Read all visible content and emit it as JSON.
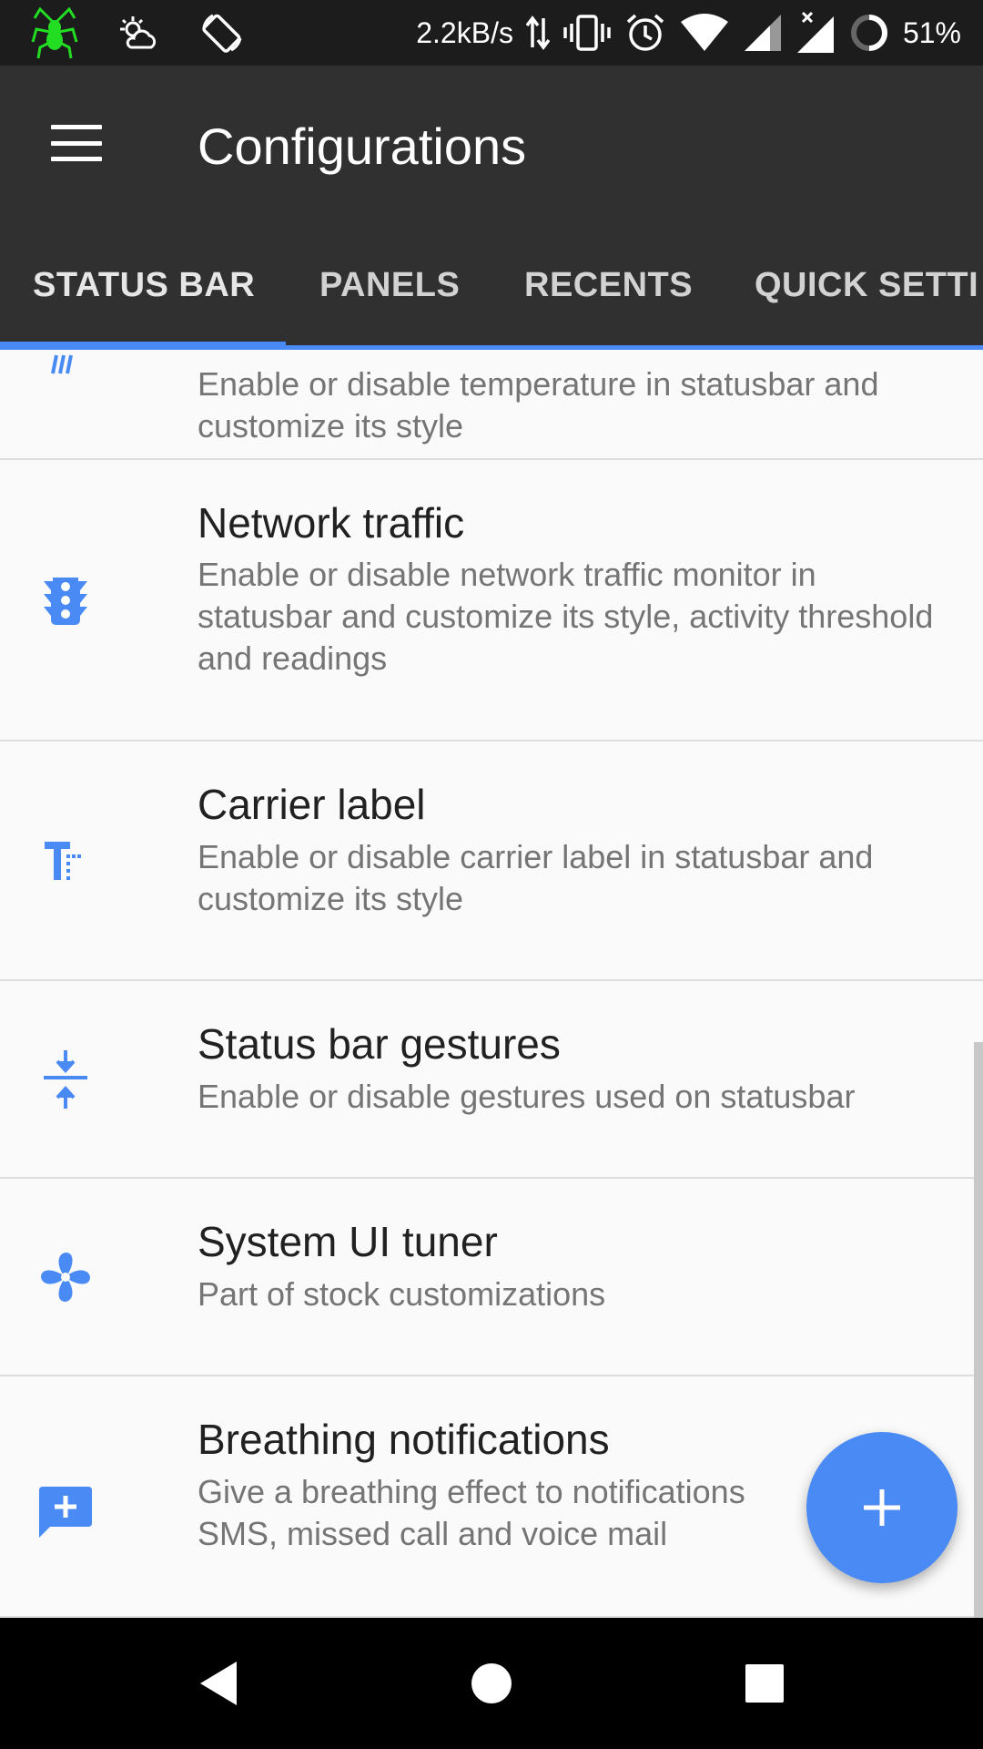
{
  "status_bar": {
    "net_speed": "2.2kB/s",
    "battery_pct": "51%",
    "icons": [
      "spider-app-icon",
      "weather-icon",
      "rotation-icon",
      "data-arrows-icon",
      "vibrate-icon",
      "alarm-icon",
      "wifi-icon",
      "signal-icon",
      "signal-no-data-icon",
      "battery-ring-icon"
    ]
  },
  "app_bar": {
    "title": "Configurations",
    "menu_icon": "hamburger-menu-icon"
  },
  "tabs": [
    {
      "label": "STATUS BAR",
      "active": true
    },
    {
      "label": "PANELS",
      "active": false
    },
    {
      "label": "RECENTS",
      "active": false
    },
    {
      "label": "QUICK SETTI",
      "active": false
    }
  ],
  "items": [
    {
      "title": "",
      "desc": "Enable or disable temperature in statusbar and customize its style",
      "icon": "thermometer-icon"
    },
    {
      "title": "Network traffic",
      "desc": "Enable or disable network traffic monitor in statusbar and customize its style, activity threshold and readings",
      "icon": "traffic-light-icon"
    },
    {
      "title": "Carrier label",
      "desc": "Enable or disable carrier label in statusbar and customize its style",
      "icon": "text-format-icon"
    },
    {
      "title": "Status bar gestures",
      "desc": "Enable or disable gestures used on statusbar",
      "icon": "compress-arrows-icon"
    },
    {
      "title": "System UI tuner",
      "desc": "Part of stock customizations",
      "icon": "fan-icon"
    },
    {
      "title": "Breathing notifications",
      "desc": "Give a breathing effect to notifications SMS, missed call and voice mail",
      "icon": "add-comment-icon"
    }
  ],
  "fab": {
    "icon": "plus-icon"
  },
  "nav_bar": {
    "icons": [
      "back-icon",
      "home-icon",
      "recents-icon"
    ]
  },
  "colors": {
    "accent": "#4a8af4",
    "appbar": "#303030",
    "statusbar": "#1c1c1c",
    "background": "#fafafa"
  }
}
